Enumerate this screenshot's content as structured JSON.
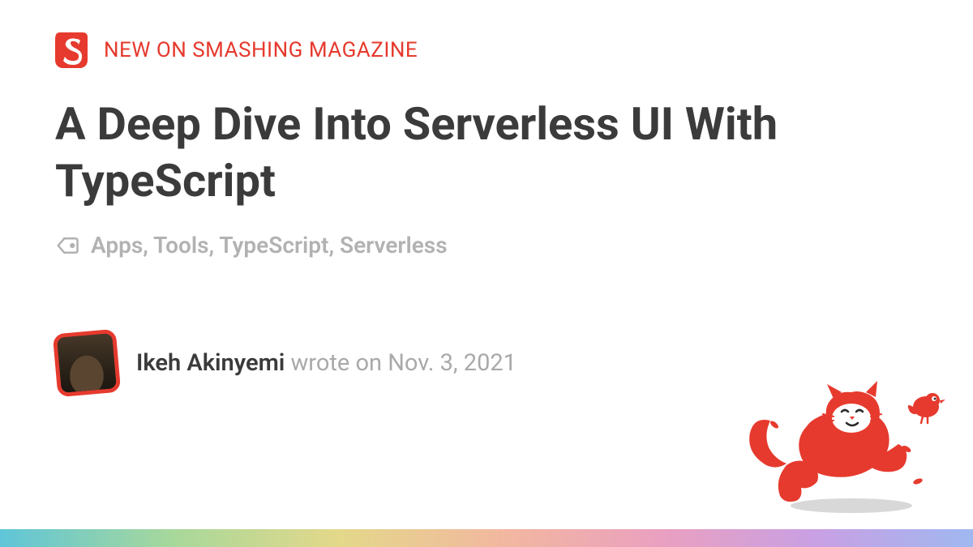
{
  "header": {
    "label": "NEW ON SMASHING MAGAZINE"
  },
  "article": {
    "title": "A Deep Dive Into Serverless UI With TypeScript",
    "tags": "Apps, Tools, TypeScript, Serverless"
  },
  "author": {
    "name": "Ikeh Akinyemi",
    "wrote_on_prefix": " wrote on ",
    "date": "Nov. 3, 2021"
  },
  "colors": {
    "brand_red": "#e63a2e",
    "text_dark": "#3b3b3b",
    "text_muted": "#b2b2b2"
  }
}
